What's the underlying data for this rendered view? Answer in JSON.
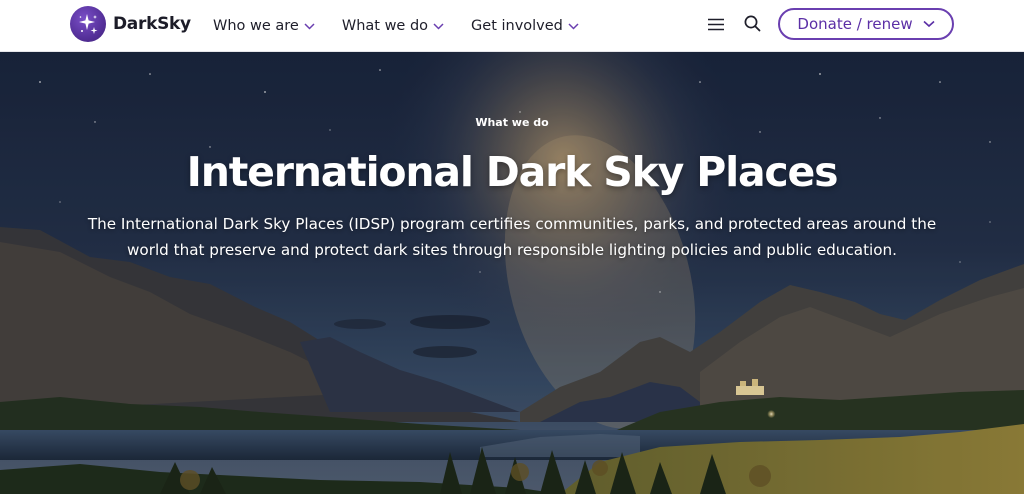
{
  "brand": {
    "name": "DarkSky"
  },
  "nav": {
    "items": [
      {
        "label": "Who we are"
      },
      {
        "label": "What we do"
      },
      {
        "label": "Get involved"
      }
    ]
  },
  "tools": {
    "menu_icon": "hamburger-menu-icon",
    "search_icon": "search-icon"
  },
  "donate": {
    "label": "Donate / renew"
  },
  "hero": {
    "eyebrow": "What we do",
    "title": "International Dark Sky Places",
    "description": "The International Dark Sky Places (IDSP) program certifies communities, parks, and protected areas around the world that preserve and protect dark sites through responsible lighting policies and public education."
  },
  "colors": {
    "brand_purple": "#5b2fa6",
    "text_dark": "#1e1e2a",
    "header_bg": "#ffffff"
  }
}
